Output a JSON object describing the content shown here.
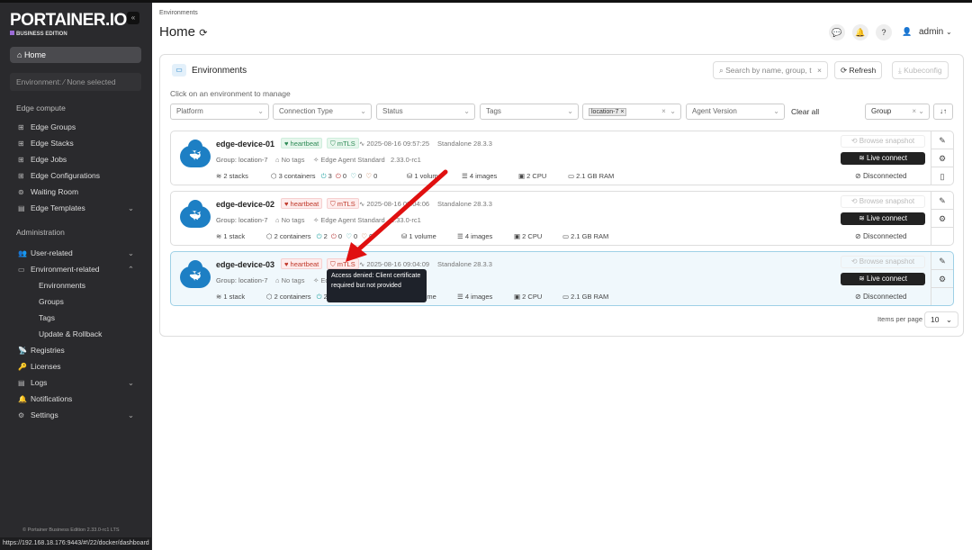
{
  "sidebar": {
    "logo": "PORTAINER.IO",
    "edition": "BUSINESS EDITION",
    "home": "Home",
    "environment": "Environment: ⁄ None selected",
    "edge_section": "Edge compute",
    "edge_items": [
      "Edge Groups",
      "Edge Stacks",
      "Edge Jobs",
      "Edge Configurations",
      "Waiting Room",
      "Edge Templates"
    ],
    "admin_section": "Administration",
    "admin_items": [
      "User-related",
      "Environment-related"
    ],
    "env_sub": [
      "Environments",
      "Groups",
      "Tags",
      "Update & Rollback"
    ],
    "other_items": [
      "Registries",
      "Licenses",
      "Logs",
      "Notifications",
      "Settings"
    ],
    "footer": "© Portainer Business Edition 2.33.0-rc1 LTS"
  },
  "status_url": "https://192.168.18.176:9443/#!/22/docker/dashboard",
  "header": {
    "breadcrumb": "Environments",
    "title": "Home",
    "user": "admin"
  },
  "panel": {
    "title": "Environments",
    "search_placeholder": "Search by name, group, t",
    "refresh": "Refresh",
    "kubeconfig": "Kubeconfig",
    "hint": "Click on an environment to manage",
    "filters": {
      "platform": "Platform",
      "connection": "Connection Type",
      "status": "Status",
      "tags": "Tags",
      "location": "location-7",
      "agent": "Agent Version",
      "clear": "Clear all",
      "sort": "Group"
    },
    "items_per_page_label": "Items per page",
    "items_per_page": "10"
  },
  "environments": [
    {
      "name": "edge-device-01",
      "heartbeat": "heartbeat",
      "mtls": "mTLS",
      "ok": true,
      "time": "2025-08-16 09:57:25",
      "type": "Standalone 28.3.3",
      "group": "Group: location-7",
      "tags": "No tags",
      "agent": "Edge Agent Standard",
      "version": "2.33.0-rc1",
      "stacks": "2 stacks",
      "containers": "3 containers",
      "running": "3",
      "stopped": "0",
      "healthy": "0",
      "unhealthy": "0",
      "volumes": "1 volume",
      "images": "4 images",
      "cpu": "2 CPU",
      "ram": "2.1 GB RAM",
      "snapshot": "Browse snapshot",
      "live": "Live connect",
      "status": "Disconnected"
    },
    {
      "name": "edge-device-02",
      "heartbeat": "heartbeat",
      "mtls": "mTLS",
      "ok": false,
      "time": "2025-08-16 09:04:06",
      "type": "Standalone 28.3.3",
      "group": "Group: location-7",
      "tags": "No tags",
      "agent": "Edge Agent Standard",
      "version": "2.33.0-rc1",
      "stacks": "1 stack",
      "containers": "2 containers",
      "running": "2",
      "stopped": "0",
      "healthy": "0",
      "unhealthy": "0",
      "volumes": "1 volume",
      "images": "4 images",
      "cpu": "2 CPU",
      "ram": "2.1 GB RAM",
      "snapshot": "Browse snapshot",
      "live": "Live connect",
      "status": "Disconnected"
    },
    {
      "name": "edge-device-03",
      "heartbeat": "heartbeat",
      "mtls": "mTLS",
      "ok": false,
      "time": "2025-08-16 09:04:09",
      "type": "Standalone 28.3.3",
      "group": "Group: location-7",
      "tags": "No tags",
      "agent": "Edge Agent Standard",
      "version": "2.33.0-rc1",
      "stacks": "1 stack",
      "containers": "2 containers",
      "running": "2",
      "stopped": "0",
      "healthy": "0",
      "unhealthy": "0",
      "volumes": "1 volume",
      "images": "4 images",
      "cpu": "2 CPU",
      "ram": "2.1 GB RAM",
      "snapshot": "Browse snapshot",
      "live": "Live connect",
      "status": "Disconnected"
    }
  ],
  "tooltip": "Access denied: Client certificate required but not provided"
}
